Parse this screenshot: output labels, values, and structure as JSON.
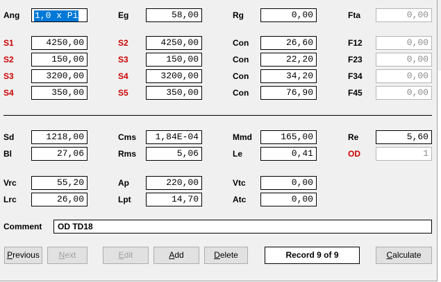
{
  "row_ang": {
    "labels": [
      "Ang",
      "Eg",
      "Rg",
      "Fta"
    ],
    "values": [
      "1,0 x Pi",
      "58,00",
      "0,00",
      "0,00"
    ]
  },
  "section_s": {
    "rows": [
      {
        "l1": "S1",
        "v1": "4250,00",
        "l2": "S2",
        "v2": "4250,00",
        "l3": "Con",
        "v3": "26,60",
        "l4": "F12",
        "v4": "0,00"
      },
      {
        "l1": "S2",
        "v1": "150,00",
        "l2": "S3",
        "v2": "150,00",
        "l3": "Con",
        "v3": "22,20",
        "l4": "F23",
        "v4": "0,00"
      },
      {
        "l1": "S3",
        "v1": "3200,00",
        "l2": "S4",
        "v2": "3200,00",
        "l3": "Con",
        "v3": "34,20",
        "l4": "F34",
        "v4": "0,00"
      },
      {
        "l1": "S4",
        "v1": "350,00",
        "l2": "S5",
        "v2": "350,00",
        "l3": "Con",
        "v3": "76,90",
        "l4": "F45",
        "v4": "0,00"
      }
    ]
  },
  "results": {
    "row1": {
      "l1": "Sd",
      "v1": "1218,00",
      "l2": "Cms",
      "v2": "1,84E-04",
      "l3": "Mmd",
      "v3": "165,00",
      "l4": "Re",
      "v4": "5,60"
    },
    "row2": {
      "l1": "Bl",
      "v1": "27,06",
      "l2": "Rms",
      "v2": "5,06",
      "l3": "Le",
      "v3": "0,41",
      "l4": "OD",
      "v4": "1"
    },
    "row3": {
      "l1": "Vrc",
      "v1": "55,20",
      "l2": "Ap",
      "v2": "220,00",
      "l3": "Vtc",
      "v3": "0,00"
    },
    "row4": {
      "l1": "Lrc",
      "v1": "26,00",
      "l2": "Lpt",
      "v2": "14,70",
      "l3": "Atc",
      "v3": "0,00"
    }
  },
  "comment": {
    "label": "Comment",
    "value": "OD TD18"
  },
  "buttons": {
    "previous": {
      "pre": "",
      "key": "P",
      "rest": "revious"
    },
    "next": {
      "pre": "",
      "key": "N",
      "rest": "ext"
    },
    "edit": {
      "pre": "",
      "key": "E",
      "rest": "dit"
    },
    "add": {
      "pre": "",
      "key": "A",
      "rest": "dd"
    },
    "delete": {
      "pre": "",
      "key": "D",
      "rest": "elete"
    },
    "calculate": {
      "pre": "",
      "key": "C",
      "rest": "alculate"
    }
  },
  "record_status": "Record 9 of 9",
  "colors": {
    "red_label": "#cc0000",
    "window_bg": "#f0f0f0",
    "selection": "#0078d7"
  }
}
